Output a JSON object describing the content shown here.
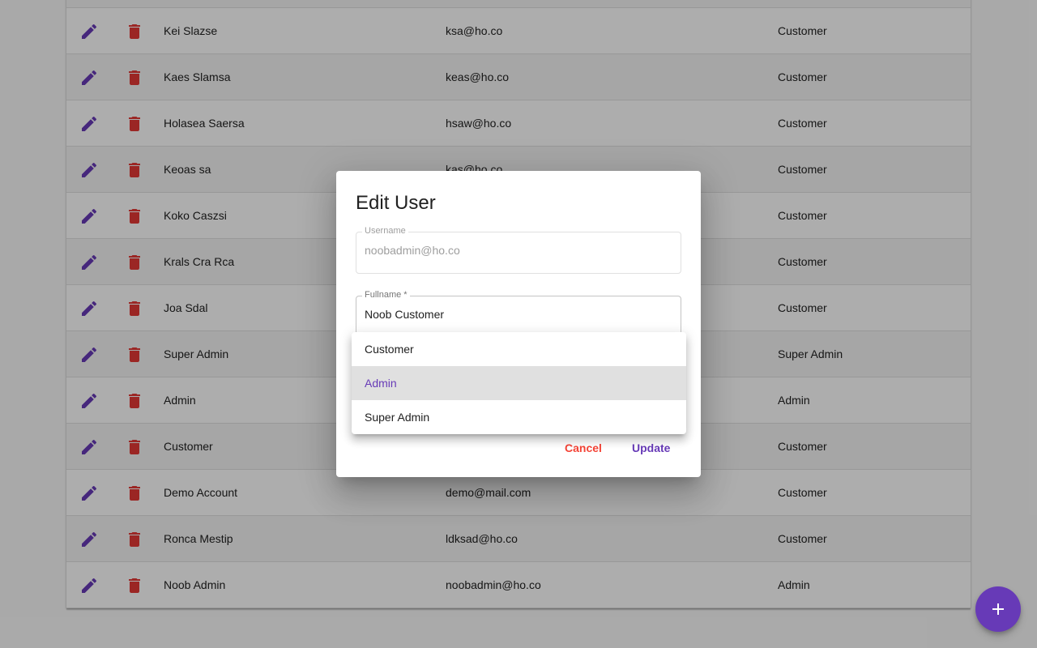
{
  "colors": {
    "primary": "#673ab7",
    "danger": "#e53935",
    "backdrop": "rgba(0,0,0,0.32)"
  },
  "table": {
    "rows": [
      {
        "name": "",
        "email": "",
        "role": ""
      },
      {
        "name": "Kei Slazse",
        "email": "ksa@ho.co",
        "role": "Customer"
      },
      {
        "name": "Kaes Slamsa",
        "email": "keas@ho.co",
        "role": "Customer"
      },
      {
        "name": "Holasea Saersa",
        "email": "hsaw@ho.co",
        "role": "Customer"
      },
      {
        "name": "Keoas sa",
        "email": "kas@ho.co",
        "role": "Customer"
      },
      {
        "name": "Koko Caszsi",
        "email": "",
        "role": "Customer"
      },
      {
        "name": "Krals Cra Rca",
        "email": "",
        "role": "Customer"
      },
      {
        "name": "Joa Sdal",
        "email": "",
        "role": "Customer"
      },
      {
        "name": "Super Admin",
        "email": "",
        "role": "Super Admin"
      },
      {
        "name": "Admin",
        "email": "",
        "role": "Admin"
      },
      {
        "name": "Customer",
        "email": "",
        "role": "Customer"
      },
      {
        "name": "Demo Account",
        "email": "demo@mail.com",
        "role": "Customer"
      },
      {
        "name": "Ronca Mestip",
        "email": "ldksad@ho.co",
        "role": "Customer"
      },
      {
        "name": "Noob Admin",
        "email": "noobadmin@ho.co",
        "role": "Admin"
      }
    ],
    "edit_icon": "pencil-icon",
    "delete_icon": "trash-icon"
  },
  "fab": {
    "icon": "plus-icon"
  },
  "dialog": {
    "title": "Edit User",
    "username": {
      "label": "Username",
      "value": "noobadmin@ho.co"
    },
    "fullname": {
      "label": "Fullname *",
      "value": "Noob Customer"
    },
    "cancel_label": "Cancel",
    "update_label": "Update"
  },
  "role_menu": {
    "options": [
      "Customer",
      "Admin",
      "Super Admin"
    ],
    "selected": "Admin"
  }
}
